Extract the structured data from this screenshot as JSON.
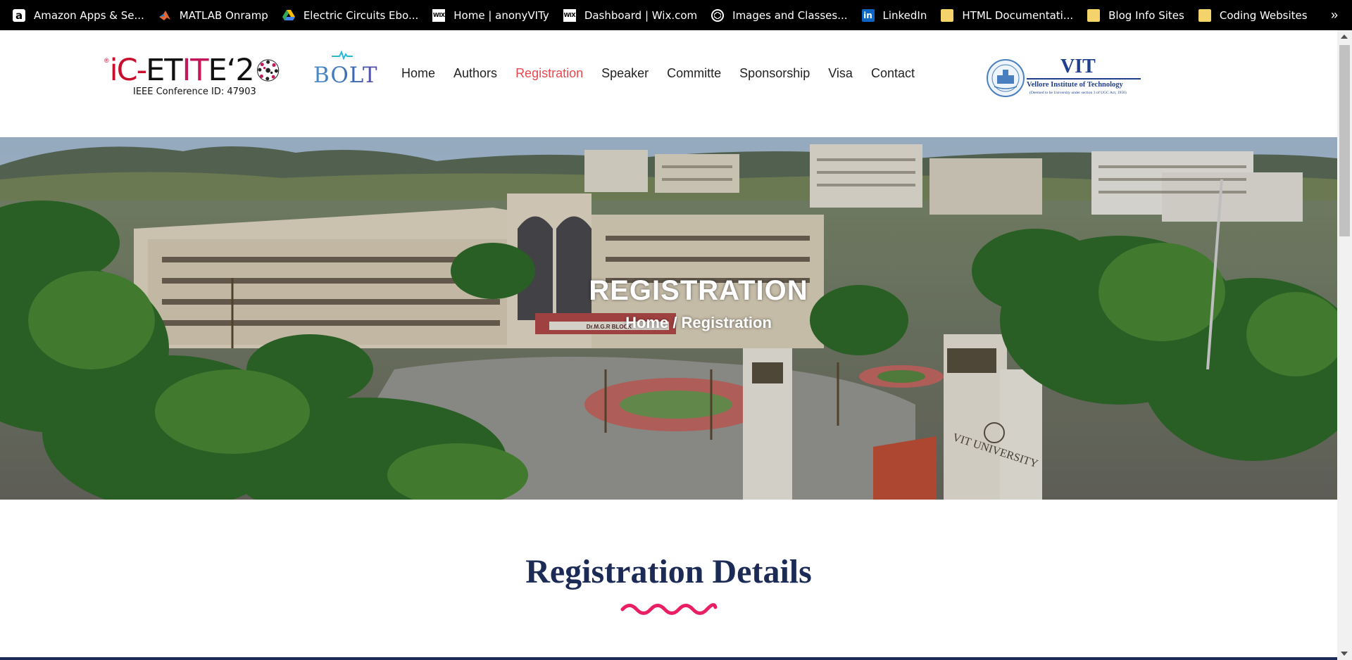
{
  "bookmarks": [
    {
      "label": "Amazon Apps & Se...",
      "icon": "amazon-icon"
    },
    {
      "label": "MATLAB Onramp",
      "icon": "matlab-icon"
    },
    {
      "label": "Electric Circuits Ebo...",
      "icon": "google-drive-icon"
    },
    {
      "label": "Home | anonyVITy",
      "icon": "wix-icon"
    },
    {
      "label": "Dashboard | Wix.com",
      "icon": "wix-icon"
    },
    {
      "label": "Images and Classes...",
      "icon": "codepen-icon"
    },
    {
      "label": "LinkedIn",
      "icon": "linkedin-icon"
    },
    {
      "label": "HTML Documentati...",
      "icon": "folder-icon"
    },
    {
      "label": "Blog Info Sites",
      "icon": "folder-icon"
    },
    {
      "label": "Coding Websites",
      "icon": "folder-icon"
    }
  ],
  "bookmarks_more": "»",
  "header": {
    "logo": {
      "reg_mark": "®",
      "part_ic": "iC-",
      "part_et": "ET",
      "part_it": "IT",
      "part_e2": "E‘2",
      "subtitle": "IEEE Conference ID: 47903"
    },
    "bolt_logo": "BOLT",
    "vit_logo": {
      "name": "VIT",
      "full": "Vellore Institute of Technology",
      "deemed": "(Deemed to be University under section 3 of UGC Act, 1956)"
    }
  },
  "nav": [
    {
      "label": "Home",
      "active": false
    },
    {
      "label": "Authors",
      "active": false
    },
    {
      "label": "Registration",
      "active": true
    },
    {
      "label": "Speaker",
      "active": false
    },
    {
      "label": "Committe",
      "active": false
    },
    {
      "label": "Sponsorship",
      "active": false
    },
    {
      "label": "Visa",
      "active": false
    },
    {
      "label": "Contact",
      "active": false
    }
  ],
  "hero": {
    "title": "REGISTRATION",
    "breadcrumb_home": "Home",
    "breadcrumb_sep": " / ",
    "breadcrumb_current": "Registration",
    "block_sign": "Dr.M.G.R BLOCK",
    "tower_sign": "VIT UNIVERSITY"
  },
  "section": {
    "title": "Registration Details"
  },
  "colors": {
    "nav_active": "#e8484e",
    "heading": "#1c2b56",
    "squiggle": "#e91e63"
  }
}
